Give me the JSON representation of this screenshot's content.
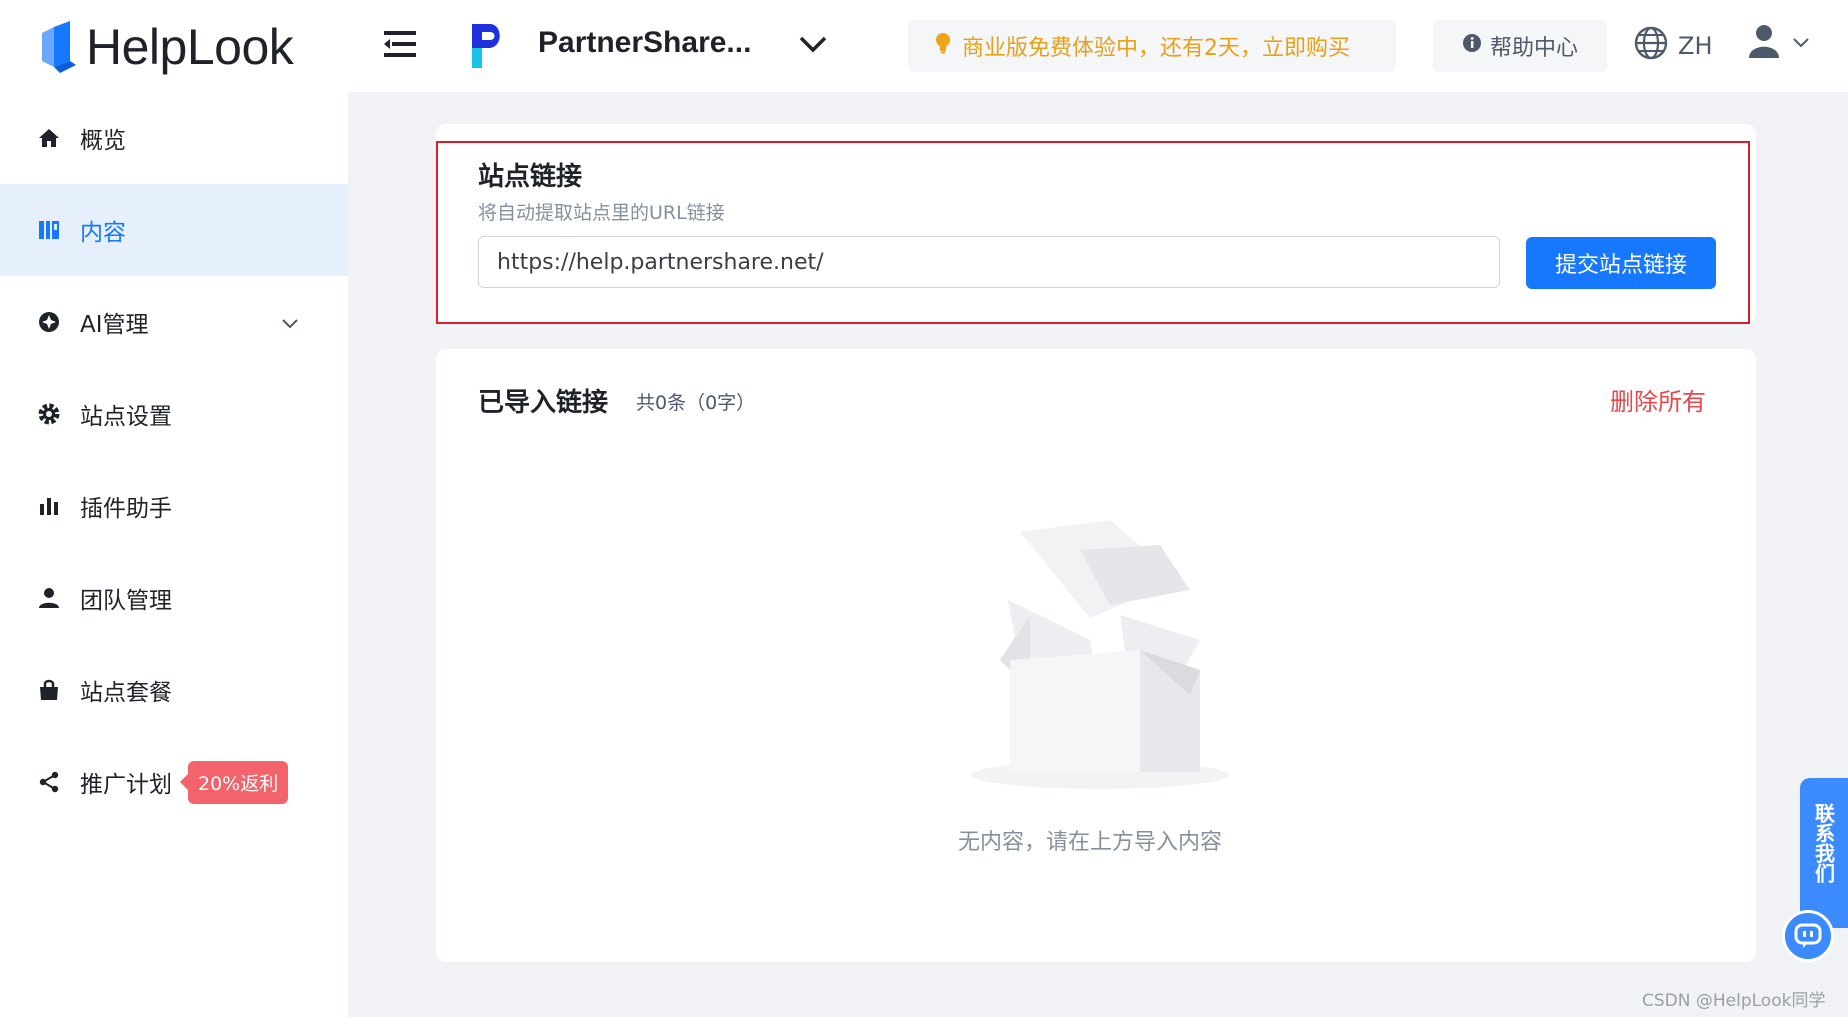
{
  "brand": {
    "name": "HelpLook"
  },
  "sidebar": {
    "items": [
      {
        "label": "概览",
        "icon": "home-icon"
      },
      {
        "label": "内容",
        "icon": "book-icon",
        "active": true
      },
      {
        "label": "AI管理",
        "icon": "ai-icon",
        "expandable": true
      },
      {
        "label": "站点设置",
        "icon": "gear-icon"
      },
      {
        "label": "插件助手",
        "icon": "bar-chart-icon"
      },
      {
        "label": "团队管理",
        "icon": "user-icon"
      },
      {
        "label": "站点套餐",
        "icon": "bag-icon"
      },
      {
        "label": "推广计划",
        "icon": "share-icon",
        "badge": "20%返利"
      }
    ]
  },
  "header": {
    "site_name": "PartnerShare...",
    "trial_text": "商业版免费体验中，还有2天，立即购买",
    "help_label": "帮助中心",
    "lang": "ZH"
  },
  "site_link": {
    "title": "站点链接",
    "description": "将自动提取站点里的URL链接",
    "url_value": "https://help.partnershare.net/",
    "submit_label": "提交站点链接"
  },
  "imported": {
    "title": "已导入链接",
    "count_text": "共0条（0字）",
    "delete_all_label": "删除所有",
    "empty_text": "无内容，请在上方导入内容"
  },
  "contact": {
    "label": "联系我们"
  },
  "watermark": "CSDN @HelpLook同学",
  "colors": {
    "primary": "#1677ff",
    "active_bg": "#e6f0fd",
    "trial_text": "#e6a01a",
    "danger": "#e5484d",
    "badge": "#f2636b",
    "highlight_border": "#d9202a"
  }
}
